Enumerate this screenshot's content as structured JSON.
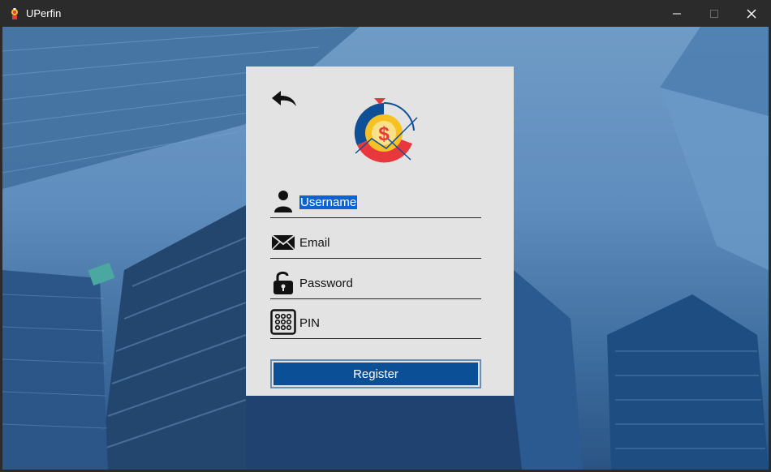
{
  "window": {
    "title": "UPerfin",
    "app_icon": "app-logo-icon",
    "controls": [
      "minimize-icon",
      "maximize-icon",
      "close-icon"
    ]
  },
  "card": {
    "back_icon": "back-arrow-icon",
    "logo_icon": "uperfin-logo-icon",
    "fields": {
      "username": {
        "icon": "user-icon",
        "placeholder": "Username",
        "selected": true
      },
      "email": {
        "icon": "envelope-icon",
        "placeholder": "Email"
      },
      "password": {
        "icon": "lock-icon",
        "placeholder": "Password"
      },
      "pin": {
        "icon": "keypad-icon",
        "placeholder": "PIN"
      }
    },
    "register_label": "Register"
  },
  "colors": {
    "titlebar": "#2b2b2b",
    "card_bg": "#e3e3e3",
    "button_bg": "#0b4f96",
    "selection": "#0a64d6",
    "logo_blue": "#0e4f98",
    "logo_red": "#e8383d",
    "logo_yellow": "#f6c223"
  }
}
